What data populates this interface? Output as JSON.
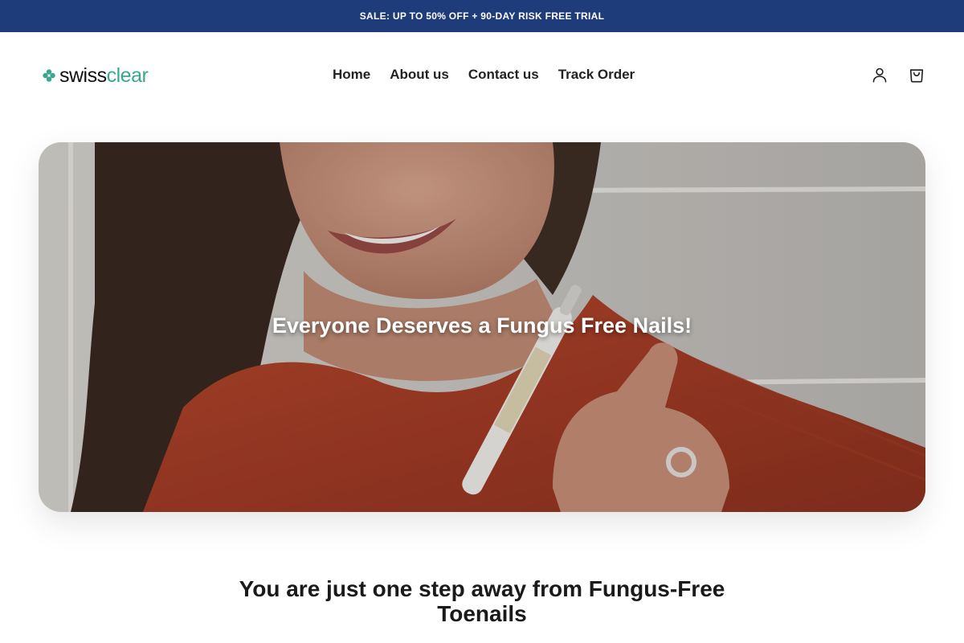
{
  "announcement": {
    "text": "SALE: UP TO 50% OFF + 90-DAY RISK FREE TRIAL"
  },
  "header": {
    "logo": {
      "part1": "swiss",
      "part2": "clear",
      "icon": "clover-icon"
    },
    "nav": [
      {
        "label": "Home"
      },
      {
        "label": "About us"
      },
      {
        "label": "Contact us"
      },
      {
        "label": "Track Order"
      }
    ],
    "icons": {
      "account": "account-icon",
      "cart": "cart-icon"
    }
  },
  "hero": {
    "title": "Everyone Deserves a Fungus Free Nails!",
    "image": "woman-holding-nail-treatment-pen-photo"
  },
  "section": {
    "heading_line1": "You are just one step away from Fungus-Free",
    "heading_line2": "Toenails"
  },
  "colors": {
    "announcement_bg": "#1e3c7a",
    "brand_accent": "#3aa88e",
    "text_dark": "#1c1c1c"
  }
}
